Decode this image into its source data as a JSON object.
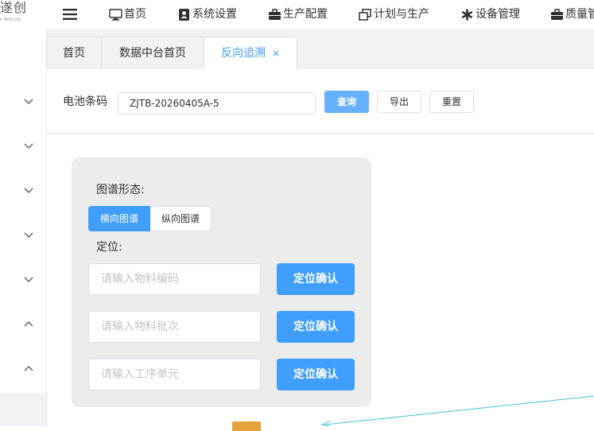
{
  "logo": {
    "text": "遂创",
    "subtext": "n Tech Ltd"
  },
  "nav": {
    "items": [
      {
        "label": "首页",
        "icon": "monitor-icon"
      },
      {
        "label": "系统设置",
        "icon": "user-card-icon"
      },
      {
        "label": "生产配置",
        "icon": "briefcase-icon"
      },
      {
        "label": "计划与生产",
        "icon": "copy-icon"
      },
      {
        "label": "设备管理",
        "icon": "asterisk-icon"
      },
      {
        "label": "质量管",
        "icon": "briefcase-icon"
      }
    ]
  },
  "tabs": [
    {
      "label": "首页"
    },
    {
      "label": "数据中台首页"
    },
    {
      "label": "反向追溯",
      "close": "×"
    }
  ],
  "query": {
    "label": "电池条码",
    "value": "ZJTB-20260405A-5",
    "btn_query": "查询",
    "btn_export": "导出",
    "btn_reset": "重置"
  },
  "panel": {
    "form_label": "图谱形态:",
    "seg_horizontal": "横向图谱",
    "seg_vertical": "纵向图谱",
    "locate_label": "定位:",
    "material_code_placeholder": "请输入物料编码",
    "material_batch_placeholder": "请输入物料批次",
    "process_unit_placeholder": "请输入工序单元",
    "locate_button": "定位确认"
  },
  "colors": {
    "primary": "#409eff",
    "primary_light": "#66b1ff",
    "node_orange": "#e6a23c",
    "edge": "#48c0d8"
  }
}
